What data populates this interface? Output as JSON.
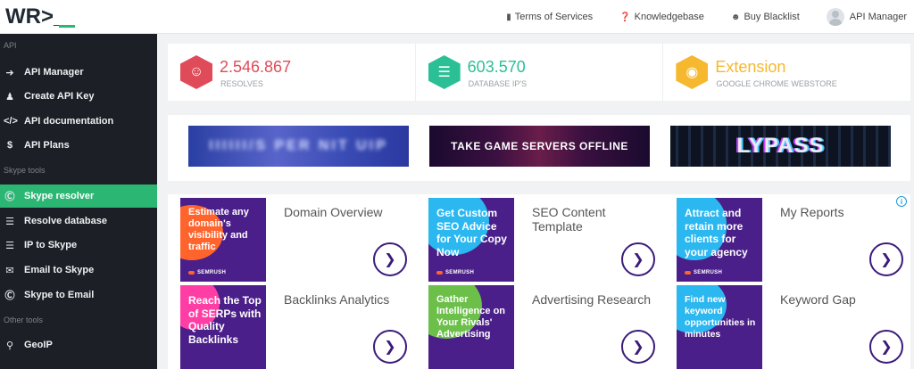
{
  "logo": {
    "text": "WR>_"
  },
  "topnav": [
    {
      "icon": "book-icon",
      "label": "Terms of Services"
    },
    {
      "icon": "question-circle-icon",
      "label": "Knowledgebase"
    },
    {
      "icon": "user-block-icon",
      "label": "Buy Blacklist"
    }
  ],
  "user": {
    "label": "API Manager"
  },
  "sidebar": {
    "sections": [
      {
        "title": "API",
        "items": [
          {
            "icon": "sign-in-icon",
            "label": "API Manager"
          },
          {
            "icon": "user-plus-icon",
            "label": "Create API Key"
          },
          {
            "icon": "code-icon",
            "label": "API documentation"
          },
          {
            "icon": "dollar-icon",
            "label": "API Plans"
          }
        ]
      },
      {
        "title": "Skype tools",
        "items": [
          {
            "icon": "skype-icon",
            "label": "Skype resolver",
            "active": true
          },
          {
            "icon": "database-icon",
            "label": "Resolve database"
          },
          {
            "icon": "database-icon",
            "label": "IP to Skype"
          },
          {
            "icon": "envelope-icon",
            "label": "Email to Skype"
          },
          {
            "icon": "skype-icon",
            "label": "Skype to Email"
          }
        ]
      },
      {
        "title": "Other tools",
        "items": [
          {
            "icon": "map-marker-icon",
            "label": "GeoIP"
          }
        ]
      }
    ]
  },
  "stats": [
    {
      "value": "2.546.867",
      "label": "RESOLVES",
      "color": "#e04b59",
      "icon": "user-icon"
    },
    {
      "value": "603.570",
      "label": "DATABASE IP'S",
      "color": "#2bbf96",
      "icon": "database-icon"
    },
    {
      "value": "Extension",
      "label": "GOOGLE CHROME WEBSTORE",
      "color": "#f5b82e",
      "icon": "chrome-icon"
    }
  ],
  "banners": [
    {
      "text": "IIIIII/S PER NIT UIP"
    },
    {
      "text": "TAKE GAME SERVERS OFFLINE"
    },
    {
      "text": "LYPASS"
    }
  ],
  "ads": {
    "brand": "SEMRUSH",
    "items": [
      {
        "tile_text": "Estimate any domain's visibility and traffic",
        "title": "Domain Overview"
      },
      {
        "tile_text": "Get Custom SEO Advice for Your Copy Now",
        "title": "SEO Content Template"
      },
      {
        "tile_text": "Attract and retain more clients for your agency",
        "title": "My Reports"
      },
      {
        "tile_text": "Reach the Top of SERPs with Quality Backlinks",
        "title": "Backlinks Analytics"
      },
      {
        "tile_text": "Gather Intelligence on Your Rivals' Advertising",
        "title": "Advertising Research"
      },
      {
        "tile_text": "Find new keyword opportunities in minutes",
        "title": "Keyword Gap"
      }
    ]
  }
}
